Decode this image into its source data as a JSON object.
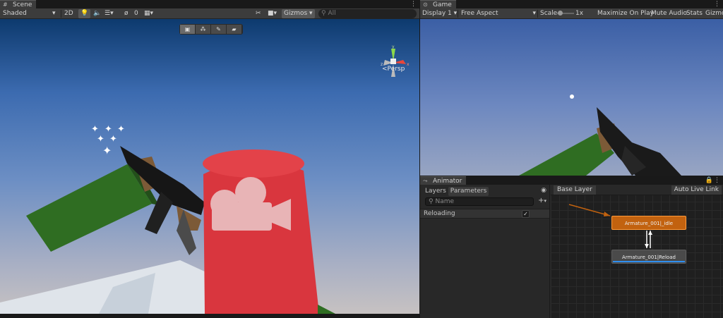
{
  "scene": {
    "tab_label": "Scene",
    "tab_icon": "grid-icon",
    "draw_mode": "Shaded",
    "mode_2d": "2D",
    "hidden_count": "0",
    "gizmos_label": "Gizmos",
    "search_placeholder": "All",
    "projection_label": "Persp",
    "gizmo_axes": {
      "y": "y",
      "z": "z",
      "x": "x"
    }
  },
  "game": {
    "tab_label": "Game",
    "display": "Display 1",
    "aspect": "Free Aspect",
    "scale_label": "Scale",
    "scale_value": "1x",
    "maximize_label": "Maximize On Play",
    "mute_label": "Mute Audio",
    "stats_label": "Stats",
    "gizmos_label": "Gizmo"
  },
  "animator": {
    "tab_label": "Animator",
    "tabs": [
      "Layers",
      "Parameters"
    ],
    "active_tab": "Parameters",
    "name_placeholder": "Name",
    "add_label": "+",
    "parameters": [
      {
        "name": "Reloading",
        "checked": true,
        "check_mark": "✓"
      }
    ],
    "breadcrumb": "Base Layer",
    "auto_live_label": "Auto Live Link",
    "states": [
      {
        "name": "Armature_001|_idle",
        "default": true
      },
      {
        "name": "Armature_001|Reload",
        "progress": 1.0
      }
    ]
  },
  "colors": {
    "editor_bg": "#282828",
    "toolbar": "#3c3c3c",
    "default_state": "#c2620f",
    "reload_progress": "#2f8ff0",
    "cylinder": "#d9363e",
    "sleeve": "#2f6d22"
  }
}
